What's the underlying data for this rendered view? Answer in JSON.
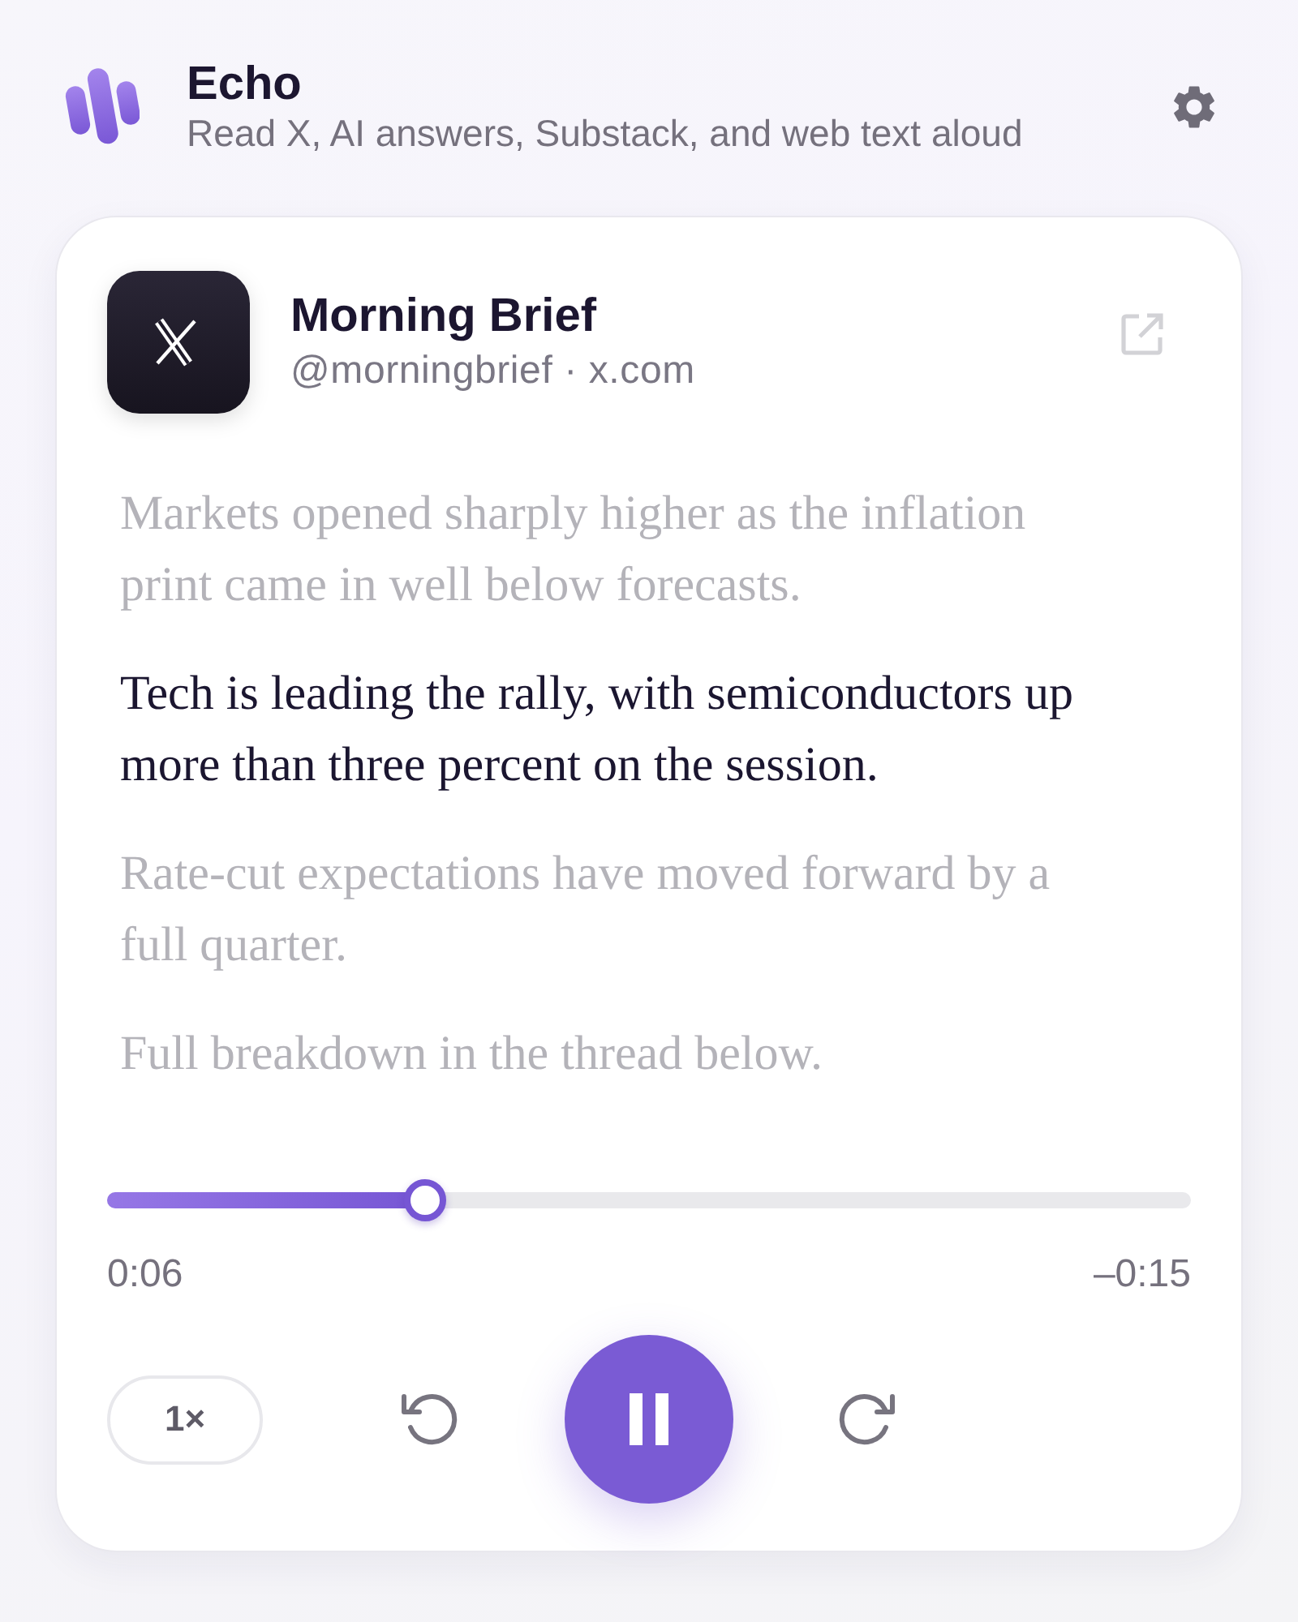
{
  "app": {
    "name": "Echo",
    "tagline": "Read X, AI answers, Substack, and web text aloud"
  },
  "source": {
    "name": "Morning Brief",
    "subtitle": "@morningbrief · x.com"
  },
  "paragraphs": [
    {
      "text": "Markets opened sharply higher as the inflation print came in well below forecasts.",
      "current": false
    },
    {
      "text": "Tech is leading the rally, with semiconductors up more than three percent on the session.",
      "current": true
    },
    {
      "text": "Rate-cut expectations have moved forward by a full quarter.",
      "current": false
    },
    {
      "text": "Full breakdown in the thread below.",
      "current": false
    }
  ],
  "player": {
    "level": 0.293,
    "elapsed": "0:06",
    "remaining": "–0:15",
    "speed": "1×",
    "playing": true
  }
}
